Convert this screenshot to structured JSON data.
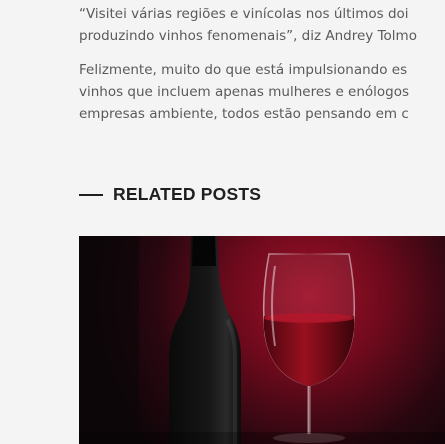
{
  "article": {
    "paragraphs": [
      {
        "lines": [
          "“Visitei várias regiões e vinícolas nos últimos doi",
          "produzindo vinhos fenomenais”, diz Andrey Tolmo"
        ]
      },
      {
        "lines": [
          "Felizmente, muito do que está impulsionando es",
          "vinhos que incluem apenas mulheres e enólogos",
          "empresas ambiente, todos estão pensando em c"
        ]
      }
    ]
  },
  "related": {
    "title": "RELATED POSTS",
    "posts": [
      {
        "image": "wine-bottle-and-glass-photo"
      }
    ]
  },
  "colors": {
    "background": "#f4f4f4",
    "heading": "#1f1f1f",
    "body_text": "#5a5a5a",
    "image_highlight": "#a0102a"
  }
}
